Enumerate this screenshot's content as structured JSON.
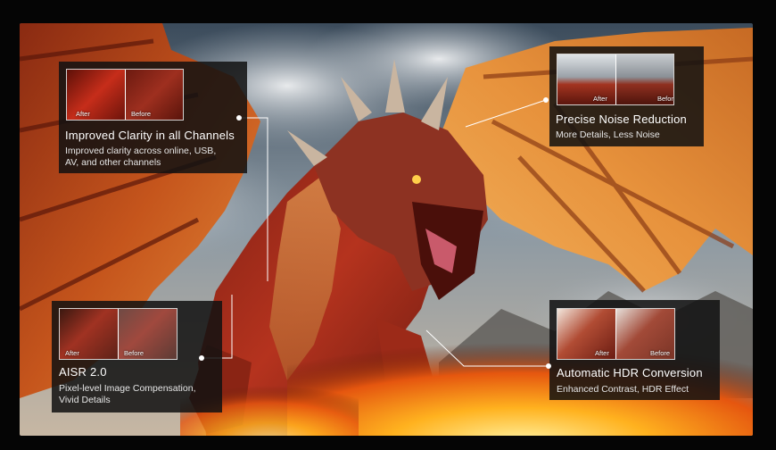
{
  "features": [
    {
      "title": "Improved Clarity in all Channels",
      "desc_lines": [
        "Improved clarity across online, USB,",
        "AV, and other channels"
      ],
      "after": "After",
      "before": "Before"
    },
    {
      "title": "Precise Noise Reduction",
      "desc_lines": [
        "More Details, Less Noise"
      ],
      "after": "After",
      "before": "Before"
    },
    {
      "title": "AISR 2.0",
      "desc_lines": [
        "Pixel-level Image Compensation,",
        "Vivid Details"
      ],
      "after": "After",
      "before": "Before"
    },
    {
      "title": "Automatic HDR Conversion",
      "desc_lines": [
        "Enhanced Contrast, HDR Effect"
      ],
      "after": "After",
      "before": "Before"
    }
  ],
  "colors": {
    "card_bg": "#121212",
    "text": "#ffffff",
    "dragon": "#b4321c",
    "wing": "#d0621f",
    "fire": "#ffb21f"
  }
}
